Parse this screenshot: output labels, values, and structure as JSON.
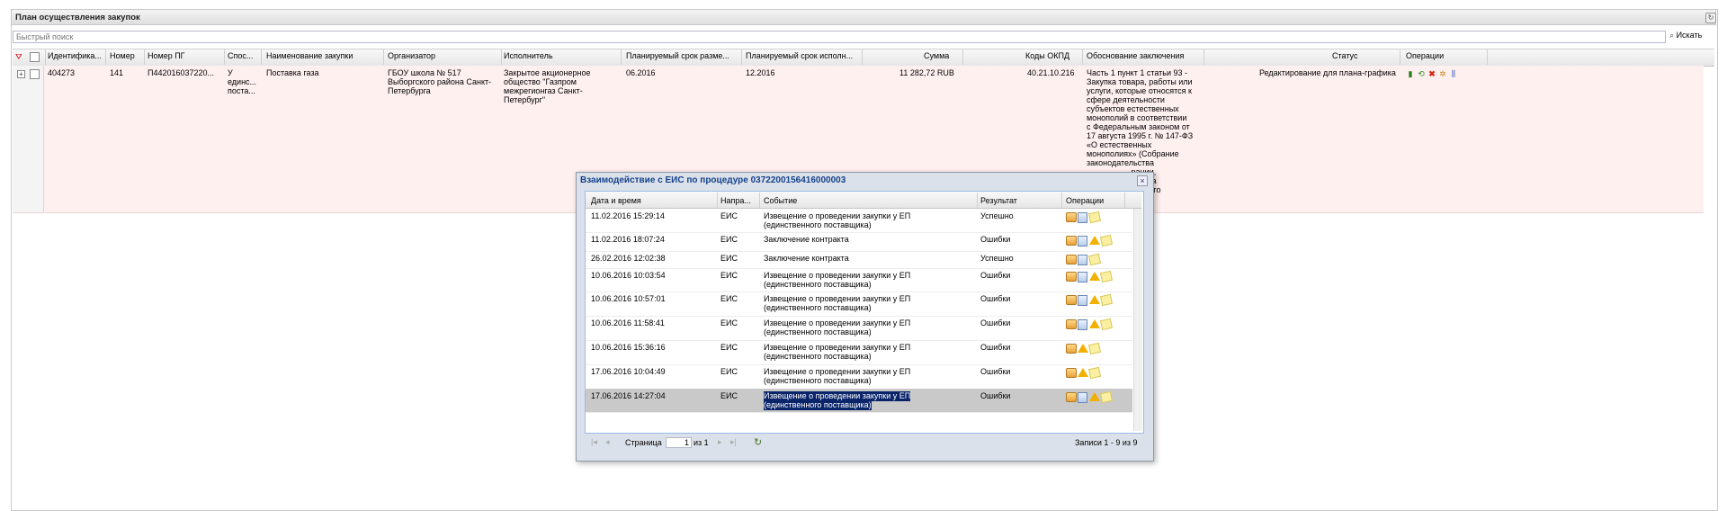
{
  "panel": {
    "title": "План осуществления закупок"
  },
  "search": {
    "placeholder": "Быстрый поиск",
    "button_label": "Искать"
  },
  "grid": {
    "columns": [
      "Идентифика...",
      "Номер",
      "Номер ПГ",
      "Спос...",
      "Наименование закупки",
      "Организатор",
      "Исполнитель",
      "Планируемый срок разме...",
      "Планируемый срок исполн...",
      "Сумма",
      "Коды ОКПД",
      "Обоснование заключения",
      "Статус",
      "Операции"
    ],
    "row": {
      "id": "404273",
      "number": "141",
      "pg_number": "П442016037220...",
      "method": [
        "У",
        "единс...",
        "поста..."
      ],
      "name": "Поставка газа",
      "organizer": [
        "ГБОУ школа № 517",
        "Выборгского района Санкт-",
        "Петербурга"
      ],
      "executor": [
        "Закрытое акционерное",
        "общество \"Газпром",
        "межрегионгаз Санкт-",
        "Петербург\""
      ],
      "placement_date": "06.2016",
      "execution_date": "12.2016",
      "sum": "11 282,72 RUB",
      "okpd": "40.21.10.216",
      "reason": [
        "Часть 1 пункт 1 статьи 93 -",
        "Закупка товара, работы или",
        "услуги, которые относятся к",
        "сфере деятельности",
        "субъектов естественных",
        "монополий в соответствии",
        "с Федеральным законом от",
        "17 августа 1995 г. № 147-ФЗ",
        "«О естественных",
        "монополиях» (Собрание",
        "законодательства",
        "...рации,",
        "...326), а",
        "...ального"
      ],
      "status": "Редактирование для плана-графика"
    }
  },
  "modal": {
    "title": "Взаимодействие с ЕИС по процедуре 0372200156416000003",
    "columns": [
      "Дата и время",
      "Напра...",
      "Событие",
      "Результат",
      "Операции"
    ],
    "rows": [
      {
        "datetime": "11.02.2016 15:29:14",
        "direction": "ЕИС",
        "event": [
          "Извещение о проведении закупки у ЕП",
          "(единственного поставщика)"
        ],
        "result": "Успешно",
        "ops": [
          "box",
          "doc",
          "note"
        ]
      },
      {
        "datetime": "11.02.2016 18:07:24",
        "direction": "ЕИС",
        "event": [
          "Заключение контракта"
        ],
        "result": "Ошибки",
        "ops": [
          "box",
          "doc",
          "warn",
          "note"
        ]
      },
      {
        "datetime": "26.02.2016 12:02:38",
        "direction": "ЕИС",
        "event": [
          "Заключение контракта"
        ],
        "result": "Успешно",
        "ops": [
          "box",
          "doc",
          "note"
        ]
      },
      {
        "datetime": "10.06.2016 10:03:54",
        "direction": "ЕИС",
        "event": [
          "Извещение о проведении закупки у ЕП",
          "(единственного поставщика)"
        ],
        "result": "Ошибки",
        "ops": [
          "box",
          "doc",
          "warn",
          "note"
        ]
      },
      {
        "datetime": "10.06.2016 10:57:01",
        "direction": "ЕИС",
        "event": [
          "Извещение о проведении закупки у ЕП",
          "(единственного поставщика)"
        ],
        "result": "Ошибки",
        "ops": [
          "box",
          "doc",
          "warn",
          "note"
        ]
      },
      {
        "datetime": "10.06.2016 11:58:41",
        "direction": "ЕИС",
        "event": [
          "Извещение о проведении закупки у ЕП",
          "(единственного поставщика)"
        ],
        "result": "Ошибки",
        "ops": [
          "box",
          "doc",
          "warn",
          "note"
        ]
      },
      {
        "datetime": "10.06.2016 15:36:16",
        "direction": "ЕИС",
        "event": [
          "Извещение о проведении закупки у ЕП",
          "(единственного поставщика)"
        ],
        "result": "Ошибки",
        "ops": [
          "box",
          "warn",
          "note"
        ]
      },
      {
        "datetime": "17.06.2016 10:04:49",
        "direction": "ЕИС",
        "event": [
          "Извещение о проведении закупки у ЕП",
          "(единственного поставщика)"
        ],
        "result": "Ошибки",
        "ops": [
          "box",
          "warn",
          "note"
        ]
      },
      {
        "datetime": "17.06.2016 14:27:04",
        "direction": "ЕИС",
        "event": [
          "Извещение о проведении закупки у ЕП",
          "(единственного поставщика)"
        ],
        "result": "Ошибки",
        "ops": [
          "box",
          "doc",
          "warn",
          "note"
        ],
        "selected": true
      }
    ],
    "paging": {
      "page_label": "Страница",
      "page_value": "1",
      "of_label": "из 1",
      "records": "Записи 1 - 9 из 9"
    }
  },
  "colors": {
    "row_bg": "#fff0f0",
    "modal_title": "#15428b",
    "selection": "#0a246a",
    "selected_row": "#c9c9c9"
  }
}
